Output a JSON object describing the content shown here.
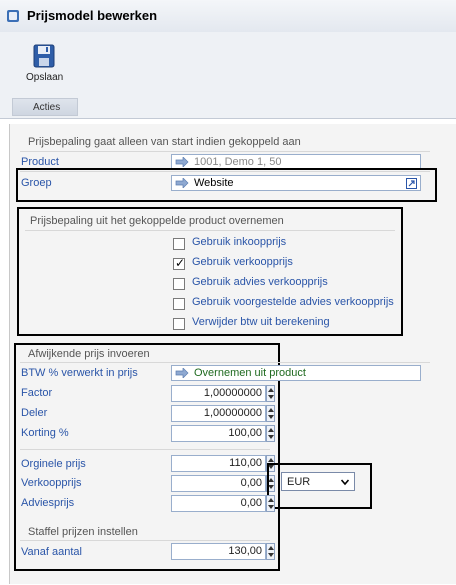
{
  "window": {
    "title": "Prijsmodel bewerken"
  },
  "ribbon": {
    "save_label": "Opslaan",
    "group_label": "Acties"
  },
  "section1": {
    "title": "Prijsbepaling gaat alleen van start indien gekoppeld aan",
    "product_label": "Product",
    "product_value": "1001, Demo 1, 50",
    "groep_label": "Groep",
    "groep_value": "Website"
  },
  "section2": {
    "title": "Prijsbepaling uit het gekoppelde product overnemen",
    "options": [
      {
        "label": "Gebruik inkoopprijs",
        "checked": false
      },
      {
        "label": "Gebruik verkoopprijs",
        "checked": true
      },
      {
        "label": "Gebruik advies verkoopprijs",
        "checked": false
      },
      {
        "label": "Gebruik voorgestelde advies verkoopprijs",
        "checked": false
      },
      {
        "label": "Verwijder btw uit berekening",
        "checked": false
      }
    ]
  },
  "section3": {
    "title": "Afwijkende prijs invoeren",
    "btw_label": "BTW % verwerkt in prijs",
    "btw_value": "Overnemen uit product",
    "factor_label": "Factor",
    "factor_value": "1,00000000",
    "deler_label": "Deler",
    "deler_value": "1,00000000",
    "korting_label": "Korting %",
    "korting_value": "100,00",
    "orginele_label": "Orginele prijs",
    "orginele_value": "110,00",
    "verkoop_label": "Verkoopprijs",
    "verkoop_value": "0,00",
    "currency_value": "EUR",
    "advies_label": "Adviesprijs",
    "advies_value": "0,00"
  },
  "section4": {
    "title": "Staffel prijzen instellen",
    "vanaf_label": "Vanaf aantal",
    "vanaf_value": "130,00"
  }
}
